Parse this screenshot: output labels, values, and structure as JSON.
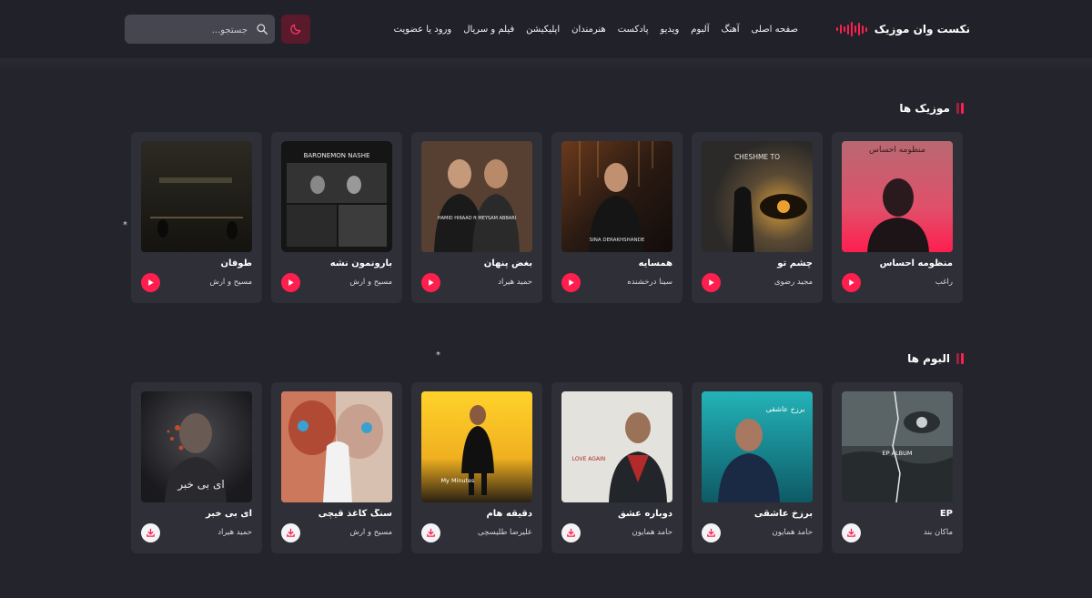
{
  "brand": {
    "name": "نکست وان موزیک",
    "accent": "#ff1f4f"
  },
  "nav": [
    "صفحه اصلی",
    "آهنگ",
    "آلبوم",
    "ویدیو",
    "پادکست",
    "هنرمندان",
    "اپلیکیشن",
    "فیلم و سریال",
    "ورود یا عضویت"
  ],
  "search": {
    "placeholder": "جستجو..."
  },
  "music": {
    "title": "موزیک ها",
    "items": [
      {
        "title": "منظومه احساس",
        "artist": "راغب",
        "cover_text": "منظومه احساس"
      },
      {
        "title": "چشم تو",
        "artist": "مجید رضوی",
        "cover_text": "CHESHME TO"
      },
      {
        "title": "همسایه",
        "artist": "سینا درخشنده",
        "cover_text": "SINA DERAKHSHANDE"
      },
      {
        "title": "بغض پنهان",
        "artist": "حمید هیراد",
        "cover_text": "HAMID HIRAAD ft MEYSAM ABBARI"
      },
      {
        "title": "بارونمون نشه",
        "artist": "مسیح و آرش",
        "cover_text": "BARONEMON NASHE"
      },
      {
        "title": "طوفان",
        "artist": "مسیح و آرش",
        "cover_text": ""
      }
    ]
  },
  "albums": {
    "title": "البوم ها",
    "items": [
      {
        "title": "EP",
        "artist": "ماکان بند",
        "cover_text": "EP ALBUM"
      },
      {
        "title": "برزخ عاشقی",
        "artist": "حامد همایون",
        "cover_text": "برزخ عاشقی"
      },
      {
        "title": "دوباره عشق",
        "artist": "حامد همایون",
        "cover_text": "LOVE AGAIN"
      },
      {
        "title": "دقیقه هام",
        "artist": "علیرضا طلیسچی",
        "cover_text": "My Minutes"
      },
      {
        "title": "سنگ کاغذ قیچی",
        "artist": "مسیح و آرش",
        "cover_text": ""
      },
      {
        "title": "ای بی خبر",
        "artist": "حمید هیراد",
        "cover_text": "ای بی خبر"
      }
    ]
  }
}
